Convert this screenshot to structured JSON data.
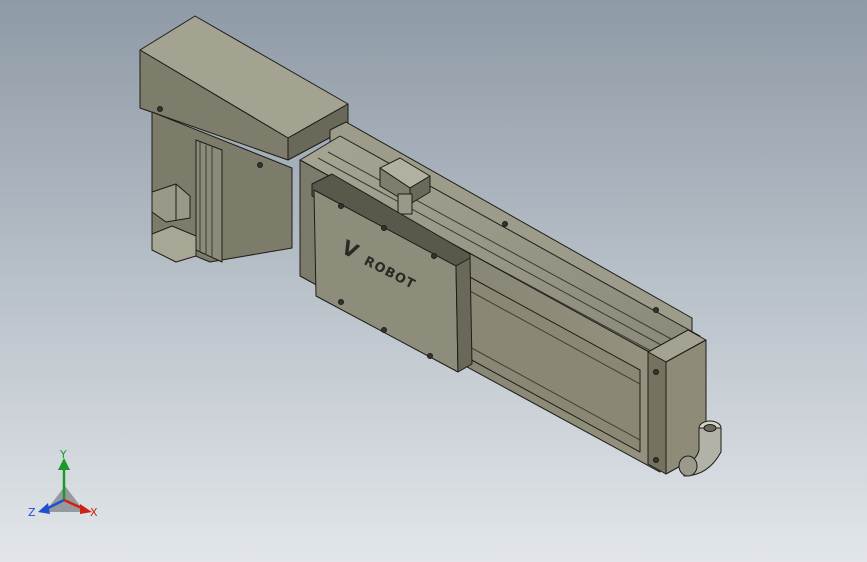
{
  "scene": {
    "background_top": "#8e9aa6",
    "background_bottom": "#e2e6ea",
    "part_color": "#8c8a78",
    "part_light": "#b3b19f",
    "part_dark": "#5e5c50",
    "edge_color": "#1d1d19"
  },
  "logo": {
    "text": "ROBOT",
    "mark": "V"
  },
  "triad": {
    "x_label": "X",
    "y_label": "Y",
    "z_label": "Z",
    "x_color": "#d0201a",
    "y_color": "#1a9a2a",
    "z_color": "#2050d0"
  }
}
